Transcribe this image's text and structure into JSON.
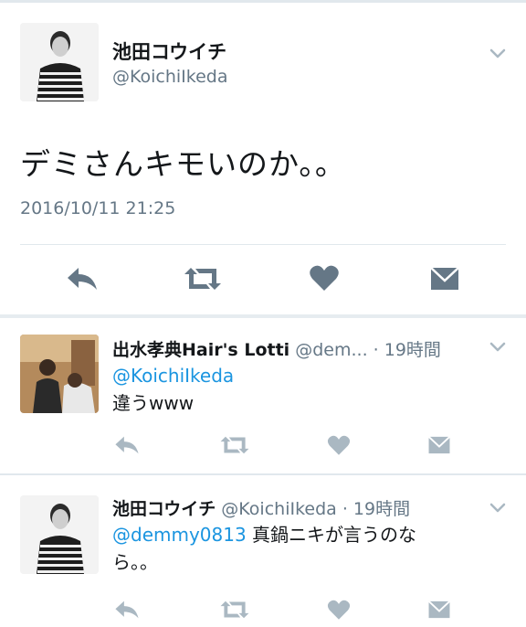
{
  "main_tweet": {
    "display_name": "池田コウイチ",
    "handle": "@KoichiIkeda",
    "text": "デミさんキモいのか。。",
    "timestamp": "2016/10/11 21:25",
    "actions": [
      "reply-icon",
      "retweet-icon",
      "heart-icon",
      "message-icon"
    ]
  },
  "replies": [
    {
      "display_name": "出水孝典Hair's Lotti",
      "meta": "@dem... · 19時間",
      "mention": "@KoichiIkeda",
      "text": "違うwww"
    },
    {
      "display_name": "池田コウイチ",
      "meta": "@KoichiIkeda · 19時間",
      "mention": "@demmy0813",
      "text_line1": " 真鍋ニキが言うのな",
      "text_line2": "ら。。"
    }
  ],
  "colors": {
    "text": "#14171a",
    "secondary": "#657786",
    "link": "#1b95e0",
    "icon": "#657786",
    "icon_faint": "#aab8c2",
    "divider": "#e1e8ed"
  }
}
